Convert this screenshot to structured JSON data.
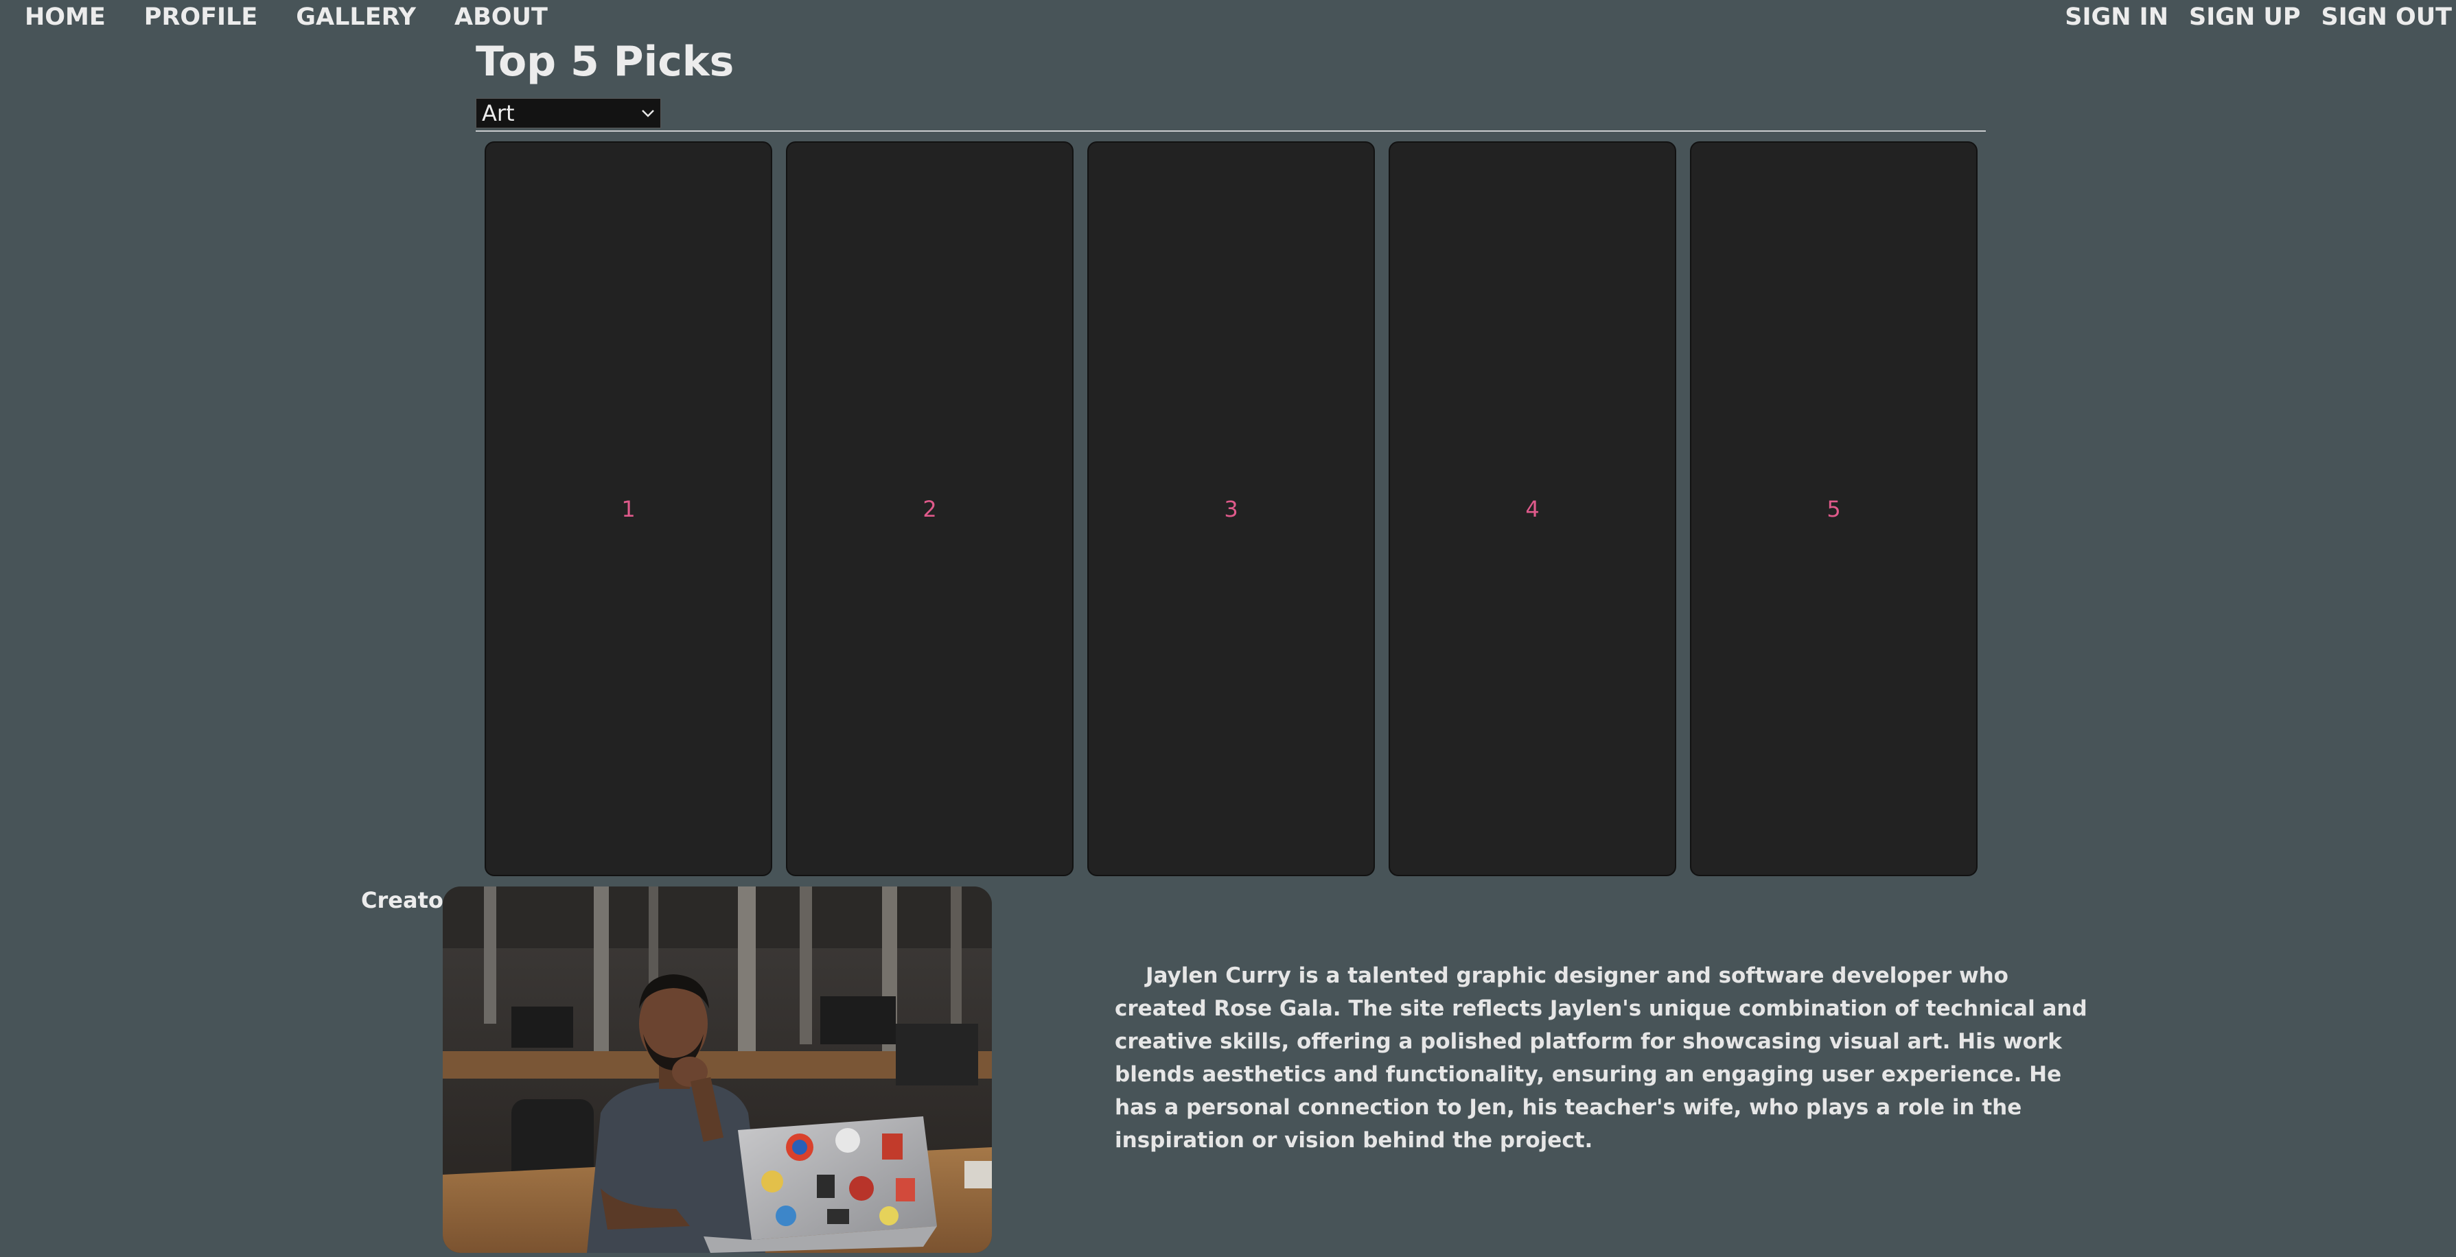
{
  "nav": {
    "left": [
      "HOME",
      "PROFILE",
      "GALLERY",
      "ABOUT"
    ],
    "right": [
      "SIGN IN",
      "SIGN UP",
      "SIGN OUT"
    ]
  },
  "page": {
    "title": "Top 5 Picks"
  },
  "category_select": {
    "selected": "Art"
  },
  "picks": [
    "1",
    "2",
    "3",
    "4",
    "5"
  ],
  "creator": {
    "label": "Creator",
    "bio": "Jaylen Curry is a talented graphic designer and software developer who created Rose Gala. The site reflects Jaylen's unique combination of technical and creative skills, offering a polished platform for showcasing visual art. His work blends aesthetics and functionality, ensuring an engaging user experience. He has a personal connection to Jen, his teacher's wife, who plays a role in the inspiration or vision behind the project."
  },
  "colors": {
    "background": "#485458",
    "card": "#222222",
    "card_number": "#e05a8b",
    "text": "#ececec"
  },
  "icons": {
    "select_arrow": "chevron-down-icon"
  }
}
